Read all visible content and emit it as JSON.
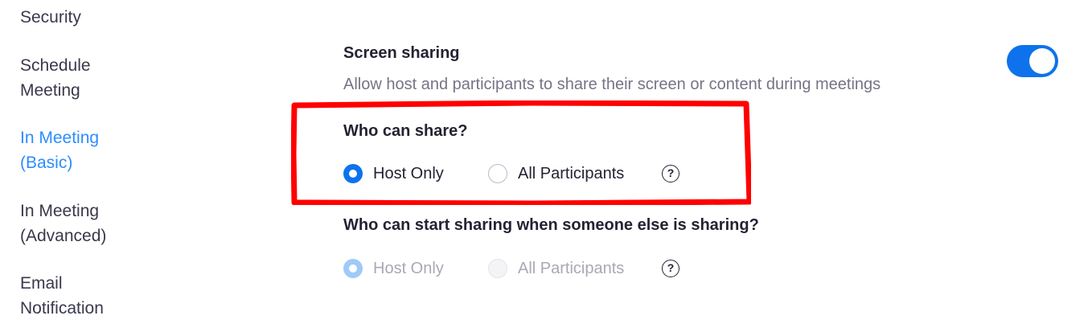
{
  "sidebar": {
    "items": [
      {
        "label": "Security"
      },
      {
        "label": "Schedule\nMeeting"
      },
      {
        "label": "In Meeting\n(Basic)"
      },
      {
        "label": "In Meeting\n(Advanced)"
      },
      {
        "label": "Email\nNotification"
      }
    ],
    "active_index": 2
  },
  "screen_sharing": {
    "title": "Screen sharing",
    "description": "Allow host and participants to share their screen or content during meetings",
    "toggle_on": true,
    "who_can_share": {
      "question": "Who can share?",
      "options": [
        "Host Only",
        "All Participants"
      ],
      "selected": "Host Only",
      "help_icon": "question-circle-icon"
    },
    "who_can_start": {
      "question": "Who can start sharing when someone else is sharing?",
      "options": [
        "Host Only",
        "All Participants"
      ],
      "selected": "Host Only",
      "disabled": true,
      "help_icon": "question-circle-icon"
    }
  },
  "colors": {
    "accent": "#0e72ed",
    "active_nav": "#2d8cff",
    "highlight_annotation": "#ff0000"
  }
}
